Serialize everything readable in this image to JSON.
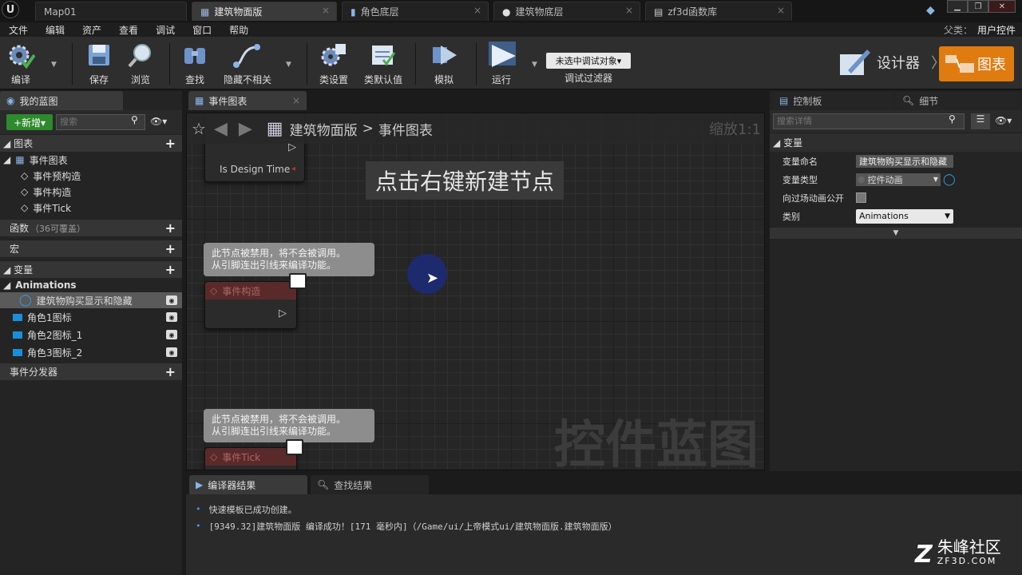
{
  "tabs": [
    {
      "label": "Map01"
    },
    {
      "label": "建筑物面版"
    },
    {
      "label": "角色底层"
    },
    {
      "label": "建筑物底层"
    },
    {
      "label": "zf3d函数库"
    }
  ],
  "menu": [
    "文件",
    "编辑",
    "资产",
    "查看",
    "调试",
    "窗口",
    "帮助"
  ],
  "parent": {
    "label": "父类：",
    "value": "用户控件"
  },
  "toolbar": {
    "compile": "编译",
    "save": "保存",
    "browse": "浏览",
    "find": "查找",
    "hide_unrelated": "隐藏不相关",
    "class_settings": "类设置",
    "class_defaults": "类默认值",
    "simulate": "模拟",
    "run": "运行",
    "debug_object": "未选中调试对象▾",
    "debug_filter": "调试过滤器",
    "designer": "设计器",
    "graph": "图表"
  },
  "left": {
    "tab": "我的蓝图",
    "new_button": "+新增▾",
    "search_placeholder": "搜索",
    "graphs": "图表",
    "event_graph": "事件图表",
    "events": [
      "事件预构造",
      "事件构造",
      "事件Tick"
    ],
    "functions": "函数",
    "functions_note": "（36可覆盖）",
    "macros": "宏",
    "variables": "变量",
    "category": "Animations",
    "vars": [
      "建筑物购买显示和隐藏",
      "角色1图标",
      "角色2图标_1",
      "角色3图标_2"
    ],
    "dispatchers": "事件分发器"
  },
  "graph": {
    "tab": "事件图表",
    "breadcrumb_root": "建筑物面版",
    "breadcrumb_sep": ">",
    "breadcrumb_leaf": "事件图表",
    "zoom": "缩放1:1",
    "hint": "点击右键新建节点",
    "pin_label": "Is Design Time",
    "disabled_msg": "此节点被禁用，将不会被调用。\n从引脚连出引线来编译功能。",
    "node_construct": "事件构造",
    "node_tick": "事件Tick",
    "watermark": "控件蓝图"
  },
  "right": {
    "tab_palette": "控制板",
    "tab_details": "细节",
    "search_placeholder": "搜索详情",
    "section": "变量",
    "rows": [
      {
        "key": "变量命名",
        "value": "建筑物购买显示和隐藏"
      },
      {
        "key": "变量类型",
        "value": "控件动画"
      },
      {
        "key": "向过场动画公开",
        "value": ""
      },
      {
        "key": "类别",
        "value": "Animations"
      }
    ]
  },
  "bottom": {
    "tab_compiler": "编译器结果",
    "tab_find": "查找结果",
    "lines": [
      "快速模板已成功创建。",
      "[9349.32]建筑物面版 编译成功！[171 毫秒内]（/Game/ui/上帝模式ui/建筑物面版.建筑物面版）"
    ]
  },
  "logo": {
    "text": "朱峰社区",
    "sub": "ZF3D.COM"
  },
  "colors": {
    "accent": "#e07b0f",
    "var_blue": "#1a8fd9",
    "cursor_circle": "#1e2a6e"
  }
}
